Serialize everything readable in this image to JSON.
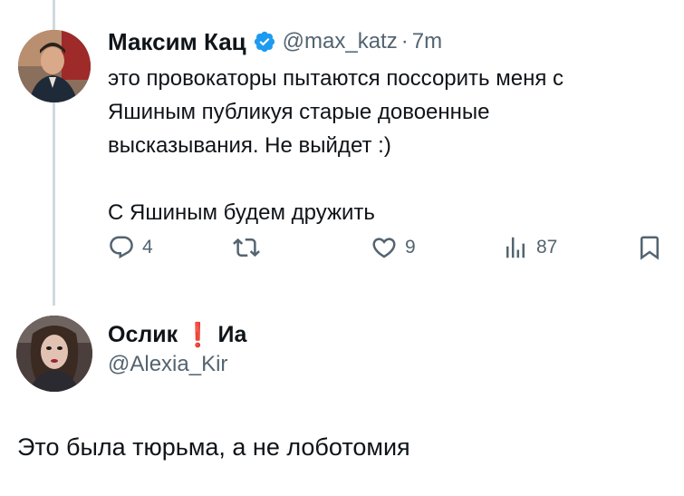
{
  "tweet1": {
    "display_name": "Максим Кац",
    "verified_icon": "verified-badge-icon",
    "handle": "@max_katz",
    "separator": "·",
    "time": "7m",
    "text_lines": [
      "это провокаторы пытаются поссорить меня с",
      "Яшиным публикуя старые довоенные",
      "высказывания. Не выйдет :)",
      "",
      "С Яшиным будем дружить"
    ],
    "actions": {
      "reply_count": "4",
      "retweet_count": "",
      "like_count": "9",
      "views_count": "87"
    }
  },
  "tweet2": {
    "display_name": "Ослик",
    "emoji": "❗",
    "display_name_suffix": "Иа",
    "handle": "@Alexia_Kir",
    "text": "Это была тюрьма, а не лоботомия"
  },
  "colors": {
    "text_primary": "#0f1419",
    "text_secondary": "#536471",
    "verified_blue": "#1d9bf0",
    "thread_line": "#cfd9de",
    "emoji_red": "#e0163a"
  }
}
